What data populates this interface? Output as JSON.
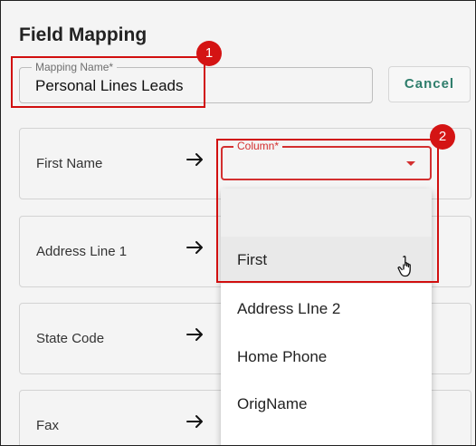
{
  "header": {
    "title": "Field Mapping"
  },
  "mapping_name": {
    "label": "Mapping Name*",
    "value": "Personal Lines Leads"
  },
  "cancel_button": {
    "label": "Cancel"
  },
  "rows": [
    {
      "label": "First Name"
    },
    {
      "label": "Address Line 1"
    },
    {
      "label": "State Code"
    },
    {
      "label": "Fax"
    }
  ],
  "column_select": {
    "label": "Column*",
    "value": ""
  },
  "dropdown": {
    "items": [
      "",
      "First",
      "Address LIne 2",
      "Home Phone",
      "OrigName"
    ]
  },
  "callouts": {
    "one": "1",
    "two": "2"
  },
  "colors": {
    "accent_error": "#d32f2f",
    "button_text": "#2e7d6b",
    "callout_red": "#d10f0f"
  },
  "icons": {
    "arrow": "arrow-right-icon",
    "caret": "caret-down-icon",
    "cursor": "hand-pointer-icon"
  }
}
